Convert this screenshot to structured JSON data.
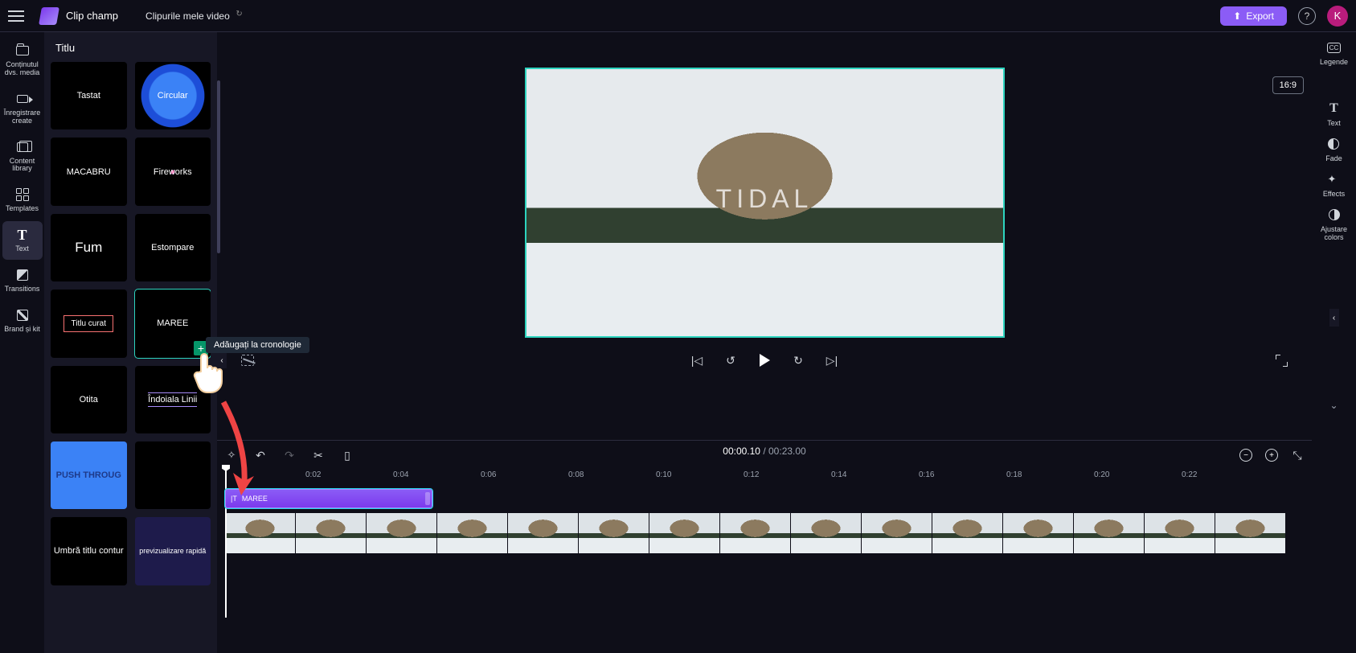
{
  "app": {
    "name": "Clip champ",
    "project_tab": "Clipurile mele video",
    "export": "Export",
    "avatar_letter": "K"
  },
  "nav": {
    "media": "Conținutul dvs. media",
    "record": "Înregistrare create",
    "library": "Content library",
    "templates": "Templates",
    "text": "Text",
    "transitions": "Transitions",
    "brand": "Brand și kit"
  },
  "panel": {
    "header": "Titlu",
    "tooltip": "Adăugați la cronologie",
    "tiles": [
      {
        "id": "tastat",
        "label": "Tastat"
      },
      {
        "id": "circular",
        "label": "Circular"
      },
      {
        "id": "macabru",
        "label": "MACABRU"
      },
      {
        "id": "fireworks",
        "label": "Fireworks"
      },
      {
        "id": "fum",
        "label": "Fum"
      },
      {
        "id": "estompare",
        "label": "Estompare"
      },
      {
        "id": "curat",
        "label": "Titlu curat"
      },
      {
        "id": "maree",
        "label": "MAREE"
      },
      {
        "id": "otita",
        "label": "Otita"
      },
      {
        "id": "linii",
        "label": "Îndoiala Linii"
      },
      {
        "id": "push",
        "label": "PUSH THROUG"
      },
      {
        "id": "blank",
        "label": ""
      },
      {
        "id": "umbra",
        "label": "Umbră titlu contur"
      },
      {
        "id": "prev",
        "label": "previzualizare rapidă"
      }
    ]
  },
  "preview": {
    "overlay_text": "TIDAL",
    "aspect": "16:9"
  },
  "playback": {
    "current": "00:00.10",
    "duration": "00:23.00"
  },
  "timeline": {
    "ticks": [
      "0:02",
      "0:04",
      "0:06",
      "0:08",
      "0:10",
      "0:12",
      "0:14",
      "0:16",
      "0:18",
      "0:20",
      "0:22"
    ],
    "title_clip": {
      "prefix": "|T",
      "name": "MAREE"
    }
  },
  "rightbar": {
    "cc": "Legende",
    "text": "Text",
    "fade": "Fade",
    "effects": "Effects",
    "adjust": "Ajustare colors"
  }
}
